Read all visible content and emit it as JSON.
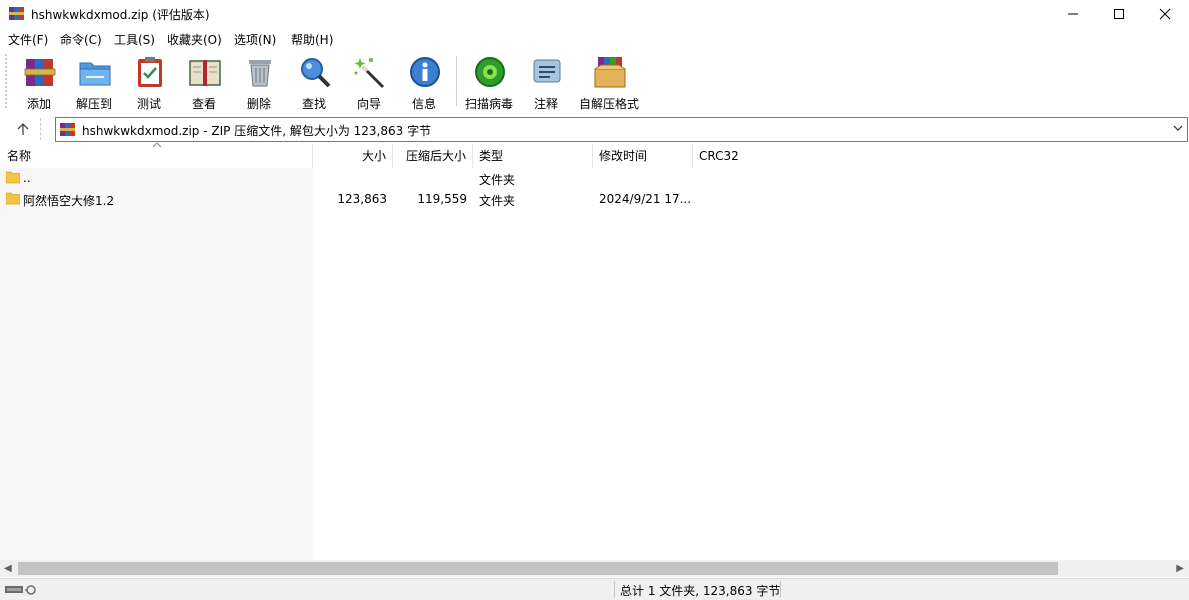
{
  "window": {
    "title": "hshwkwkdxmod.zip (评估版本)"
  },
  "menu": [
    "文件(F)",
    "命令(C)",
    "工具(S)",
    "收藏夹(O)",
    "选项(N)",
    "帮助(H)"
  ],
  "toolbar": {
    "add": "添加",
    "extract": "解压到",
    "test": "测试",
    "view": "查看",
    "delete": "删除",
    "find": "查找",
    "wizard": "向导",
    "info": "信息",
    "scan": "扫描病毒",
    "comment": "注释",
    "sfx": "自解压格式"
  },
  "address": {
    "text": "hshwkwkdxmod.zip - ZIP 压缩文件, 解包大小为 123,863 字节"
  },
  "columns": {
    "name": "名称",
    "size": "大小",
    "packed": "压缩后大小",
    "type": "类型",
    "modified": "修改时间",
    "crc": "CRC32"
  },
  "rows": [
    {
      "name": "..",
      "size": "",
      "packed": "",
      "type": "文件夹",
      "modified": "",
      "crc": ""
    },
    {
      "name": "阿然悟空大修1.2",
      "size": "123,863",
      "packed": "119,559",
      "type": "文件夹",
      "modified": "2024/9/21 17...",
      "crc": ""
    }
  ],
  "status": {
    "summary": "总计 1 文件夹, 123,863 字节"
  },
  "colors": {
    "folder": "#f5c542",
    "winrar_red": "#b3262e",
    "selection": "#cce8ff"
  }
}
